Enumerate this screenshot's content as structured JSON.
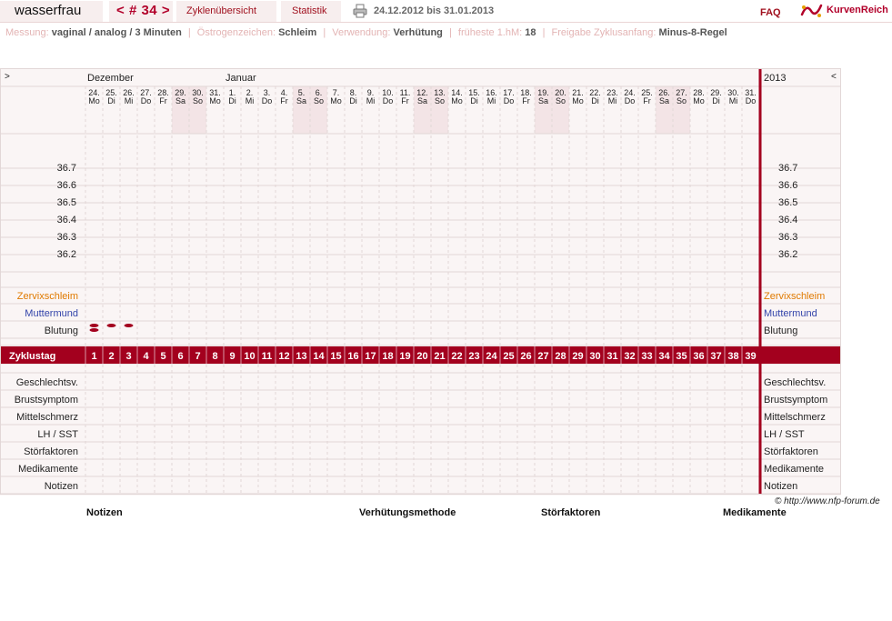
{
  "app": {
    "user": "wasserfrau",
    "cycle_prev": "<",
    "cycle_label": "# 34",
    "cycle_next": ">",
    "nav_overview": "Zyklenübersicht",
    "nav_stats": "Statistik",
    "date_range": "24.12.2012 bis 31.01.2013",
    "faq": "FAQ",
    "brand": "KurvenReich"
  },
  "settings": [
    {
      "label": "Messung:",
      "value": "vaginal / analog / 3 Minuten"
    },
    {
      "label": "Östrogenzeichen:",
      "value": "Schleim"
    },
    {
      "label": "Verwendung:",
      "value": "Verhütung"
    },
    {
      "label": "früheste 1.hM:",
      "value": "18"
    },
    {
      "label": "Freigabe Zyklusanfang:",
      "value": "Minus-8-Regel"
    }
  ],
  "chart": {
    "nav_left": ">",
    "nav_right": "<",
    "year": "2013",
    "month_labels": [
      {
        "name": "Dezember",
        "day_index": 0
      },
      {
        "name": "Januar",
        "day_index": 8
      }
    ],
    "days": [
      {
        "d": "24.",
        "w": "Mo"
      },
      {
        "d": "25.",
        "w": "Di"
      },
      {
        "d": "26.",
        "w": "Mi"
      },
      {
        "d": "27.",
        "w": "Do"
      },
      {
        "d": "28.",
        "w": "Fr"
      },
      {
        "d": "29.",
        "w": "Sa"
      },
      {
        "d": "30.",
        "w": "So"
      },
      {
        "d": "31.",
        "w": "Mo"
      },
      {
        "d": "1.",
        "w": "Di"
      },
      {
        "d": "2.",
        "w": "Mi"
      },
      {
        "d": "3.",
        "w": "Do"
      },
      {
        "d": "4.",
        "w": "Fr"
      },
      {
        "d": "5.",
        "w": "Sa"
      },
      {
        "d": "6.",
        "w": "So"
      },
      {
        "d": "7.",
        "w": "Mo"
      },
      {
        "d": "8.",
        "w": "Di"
      },
      {
        "d": "9.",
        "w": "Mi"
      },
      {
        "d": "10.",
        "w": "Do"
      },
      {
        "d": "11.",
        "w": "Fr"
      },
      {
        "d": "12.",
        "w": "Sa"
      },
      {
        "d": "13.",
        "w": "So"
      },
      {
        "d": "14.",
        "w": "Mo"
      },
      {
        "d": "15.",
        "w": "Di"
      },
      {
        "d": "16.",
        "w": "Mi"
      },
      {
        "d": "17.",
        "w": "Do"
      },
      {
        "d": "18.",
        "w": "Fr"
      },
      {
        "d": "19.",
        "w": "Sa"
      },
      {
        "d": "20.",
        "w": "So"
      },
      {
        "d": "21.",
        "w": "Mo"
      },
      {
        "d": "22.",
        "w": "Di"
      },
      {
        "d": "23.",
        "w": "Mi"
      },
      {
        "d": "24.",
        "w": "Do"
      },
      {
        "d": "25.",
        "w": "Fr"
      },
      {
        "d": "26.",
        "w": "Sa"
      },
      {
        "d": "27.",
        "w": "So"
      },
      {
        "d": "28.",
        "w": "Mo"
      },
      {
        "d": "29.",
        "w": "Di"
      },
      {
        "d": "30.",
        "w": "Mi"
      },
      {
        "d": "31.",
        "w": "Do"
      }
    ],
    "temp_labels": [
      "36.7",
      "36.6",
      "36.5",
      "36.4",
      "36.3",
      "36.2"
    ],
    "cycle_day_label": "Zyklustag",
    "cycle_days": [
      "1",
      "2",
      "3",
      "4",
      "5",
      "6",
      "7",
      "8",
      "9",
      "10",
      "11",
      "12",
      "13",
      "14",
      "15",
      "16",
      "17",
      "18",
      "19",
      "20",
      "21",
      "22",
      "23",
      "24",
      "25",
      "26",
      "27",
      "28",
      "29",
      "30",
      "31",
      "32",
      "33",
      "34",
      "35",
      "36",
      "37",
      "38",
      "39"
    ],
    "bleeding_days": [
      1,
      2,
      3
    ],
    "lanes_top": [
      {
        "label": "Zervixschleim",
        "color": "#e07a00"
      },
      {
        "label": "Muttermund",
        "color": "#3344aa"
      },
      {
        "label": "Blutung",
        "color": "#222222"
      }
    ],
    "lanes_bottom": [
      "Geschlechtsv.",
      "Brustsymptom",
      "Mittelschmerz",
      "LH / SST",
      "Störfaktoren",
      "Medikamente",
      "Notizen"
    ],
    "colors": {
      "accent": "#a3001e",
      "weekend": "#f3e4e6",
      "band": "#a3001e",
      "grid": "#e2d7d7"
    }
  },
  "footer": {
    "copyright": "© http://www.nfp-forum.de",
    "headings": [
      "Notizen",
      "Verhütungsmethode",
      "Störfaktoren",
      "Medikamente"
    ]
  }
}
